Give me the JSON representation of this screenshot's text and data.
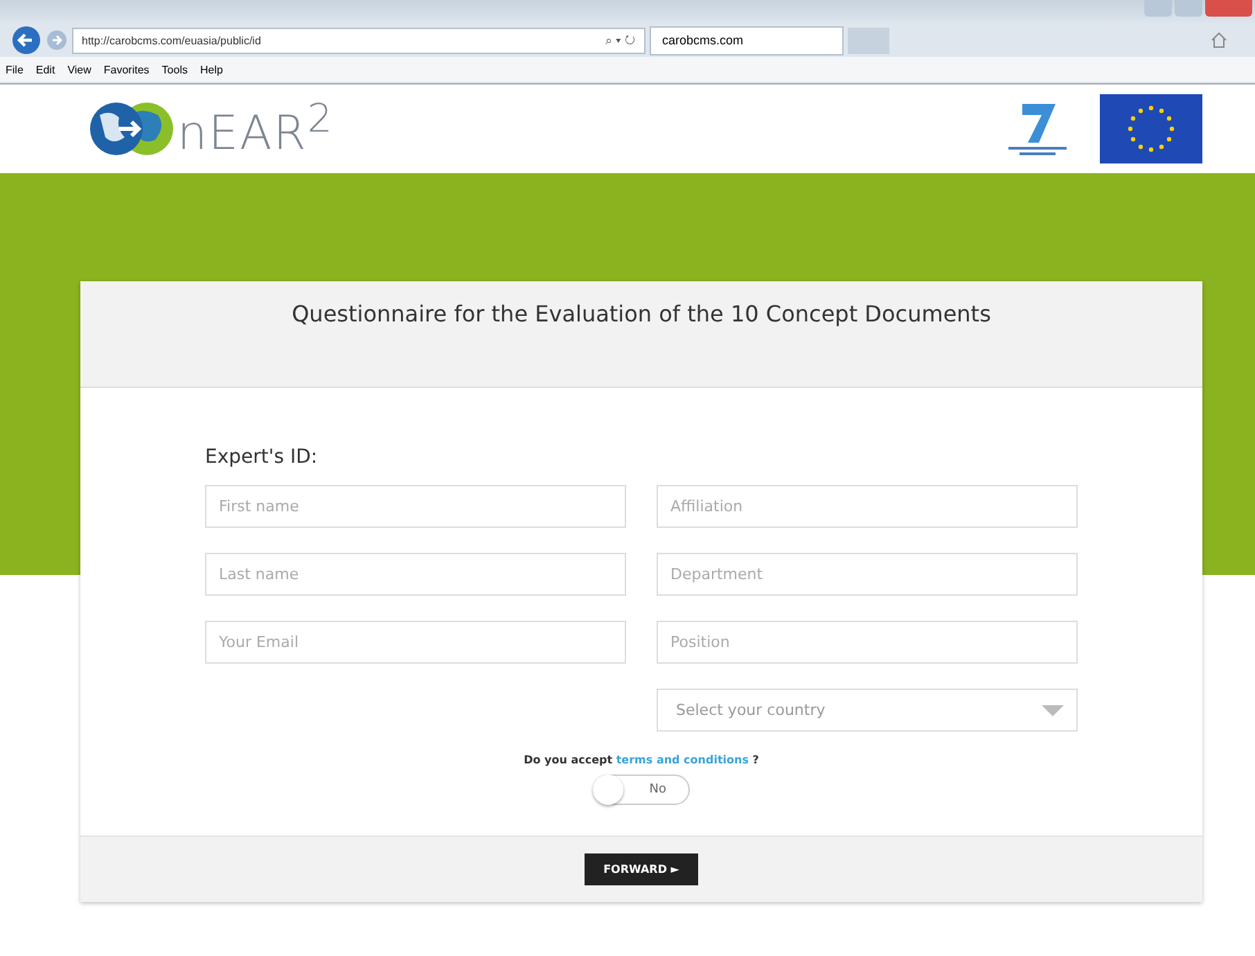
{
  "browser": {
    "url": "http://carobcms.com/euasia/public/id",
    "tab_title": "carobcms.com",
    "search_glyph": "⌕ ▾ ↻",
    "menu": [
      "File",
      "Edit",
      "View",
      "Favorites",
      "Tools",
      "Help"
    ]
  },
  "site": {
    "logo_text": "nEAR$^{2}$"
  },
  "card": {
    "title": "Questionnaire for the Evaluation of the 10 Concept Documents",
    "section": "Expert's ID:",
    "fields": [
      {
        "placeholder": "First name"
      },
      {
        "placeholder": "Affiliation"
      },
      {
        "placeholder": "Last name"
      },
      {
        "placeholder": "Department"
      },
      {
        "placeholder": "Your Email"
      },
      {
        "placeholder": "Position"
      }
    ],
    "country": {
      "placeholder": "Select your country"
    },
    "terms": {
      "before": "Do you accept",
      "link": "terms and conditions",
      "after": "?"
    },
    "toggle": {
      "on": false,
      "label": "No"
    },
    "button": "FORWARD ►"
  }
}
